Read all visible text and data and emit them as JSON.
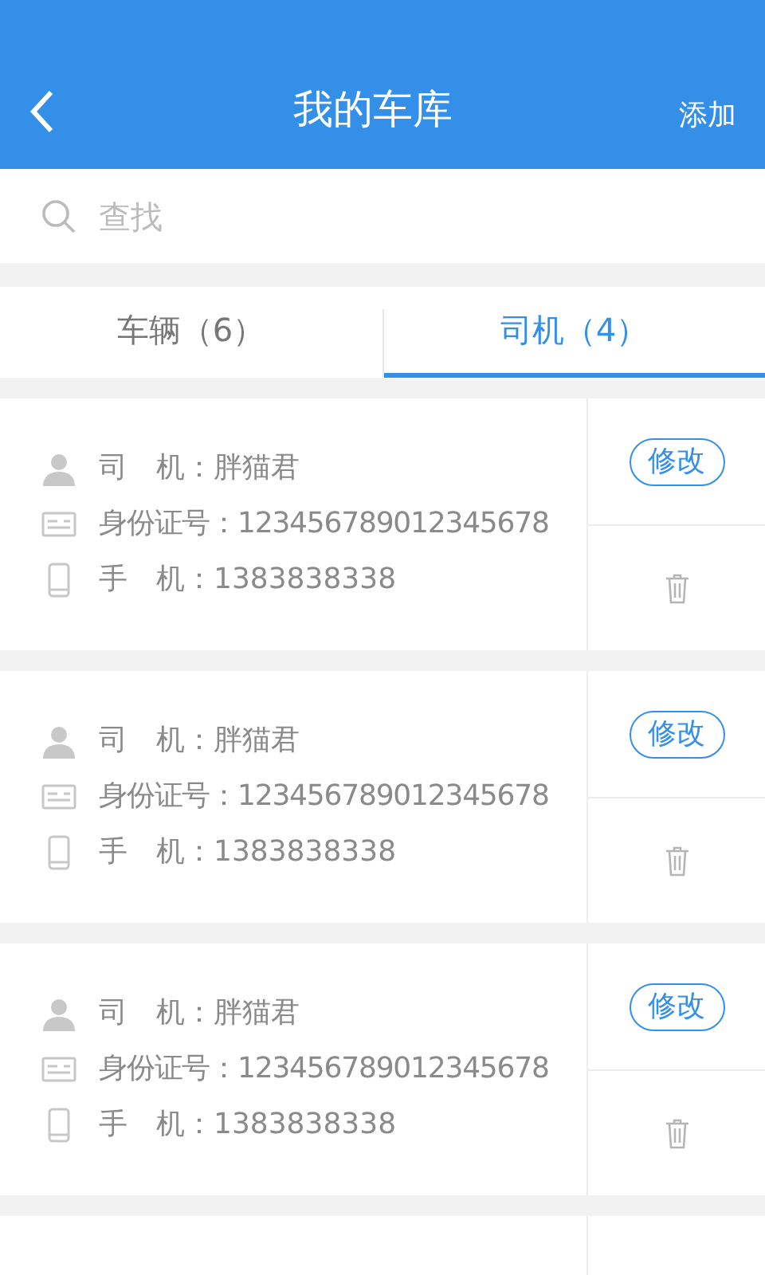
{
  "header": {
    "title": "我的车库",
    "action": "添加"
  },
  "search": {
    "placeholder": "查找"
  },
  "tabs": [
    {
      "label": "车辆（6）",
      "selected": false
    },
    {
      "label": "司机（4）",
      "selected": true
    }
  ],
  "drivers": [
    {
      "name_line": "司　机：胖猫君",
      "id_line": "身份证号：123456789012345678",
      "phone_line": "手　机：1383838338",
      "edit": "修改"
    },
    {
      "name_line": "司　机：胖猫君",
      "id_line": "身份证号：123456789012345678",
      "phone_line": "手　机：1383838338",
      "edit": "修改"
    },
    {
      "name_line": "司　机：胖猫君",
      "id_line": "身份证号：123456789012345678",
      "phone_line": "手　机：1383838338",
      "edit": "修改"
    }
  ]
}
